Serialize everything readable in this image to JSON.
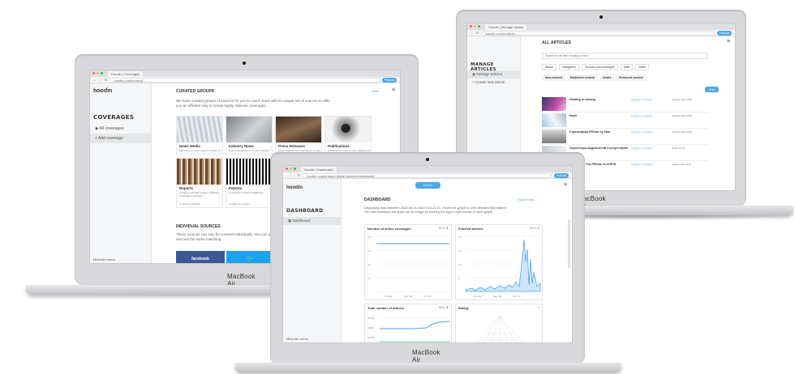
{
  "laptop_brand": "MacBook Air",
  "coverages_screen": {
    "tab_title": "Hoodin | Coverages",
    "url": "hoodin.com/product/...",
    "user_pill": "Pascal",
    "logo": "hoodin",
    "side_title": "COVERAGES",
    "side_items": [
      "All coverages",
      "Add coverage"
    ],
    "minimize": "Minimize menu",
    "section_title": "CURATED GROUPS",
    "section_link": "Hide",
    "intro": "We have curated groups of sources for you to cover. Each with its unique set of sources to offer you an efficient way to create highly relevant coverages.",
    "cards": [
      {
        "title": "News Media",
        "desc": "Mainstream news media from local to international outlets.",
        "meta": "Contains 63 sources"
      },
      {
        "title": "Industry News",
        "desc": "News and updates from your industry.",
        "meta": "Contains 19 sources"
      },
      {
        "title": "Press Releases",
        "desc": "Press releases from companies & organizations.",
        "meta": "Contains 34 sources"
      },
      {
        "title": "Publications",
        "desc": "Publications & reports from leading publishers.",
        "meta": "Contains 26 sources"
      },
      {
        "title": "Reports",
        "desc": "Articles & scientific studies published by academic journals.",
        "meta": "Contains 8 sources"
      },
      {
        "title": "Patents",
        "desc": "A collection of patent databases.",
        "meta": "Contains 3 sources"
      }
    ],
    "individual_title": "INDIVIDUAL SOURCES",
    "individual_intro": "These sources can only be covered individually. You can add pages or accounts for each source and use the same matching.",
    "social": [
      "facebook",
      "twitter"
    ],
    "social_colors": [
      "#3b5998",
      "#1da1f2"
    ]
  },
  "articles_screen": {
    "tab_title": "Hoodin | Manage stories",
    "url": "hoodin.com/product/...",
    "user_pill": "Pascal",
    "side_title": "MANAGE ARTICLES",
    "side_items": [
      "Manage articles",
      "Create new article"
    ],
    "header": "ALL ARTICLES",
    "search_placeholder": "Search for an item heading or text",
    "filters": [
      "Status",
      "Categories",
      "Sources and coverages",
      "Date",
      "Other"
    ],
    "tabs": [
      "New content",
      "Published content",
      "Drafts",
      "Removed content"
    ],
    "edit_button": "Edit",
    "rows": [
      {
        "title": "Heading is missing",
        "status": "Category is missing",
        "date": "October 16th 2018"
      },
      {
        "title": "Hepti",
        "status": "Category is missing",
        "date": "October 16th 2018"
      },
      {
        "title": "Стратосфера PRCam by Sara",
        "status": "Category is missing",
        "date": "October 16th 2018"
      },
      {
        "title": "Скульпторы видеосистем и сопутствующих продуктов...",
        "status": "Category is missing",
        "date": "Today 19:53"
      },
      {
        "title": "Leafiesting This PRCam VLOGP18",
        "status": "Category is missing",
        "date": "August 23rd 2018"
      }
    ]
  },
  "dashboard_screen": {
    "tab_title": "Hoodin | Dashboard",
    "url": "hoodin.com/product-digital-services/dashboard",
    "user_pill": "Pascal",
    "top_button": "Demo",
    "logo": "hoodin",
    "side_title": "DASHBOARD",
    "side_items": [
      "Dashboard"
    ],
    "minimize": "Minimize menu",
    "title": "DASHBOARD",
    "link": "Export view",
    "intro": "Displaying data between 2018-08-01 and 2018-11-07. Hover the graph to view detailed information. You can download the graph as an image by clicking the upper right corner of each graph.",
    "panels": [
      "Number of active coverages",
      "Fetched articles",
      "Total number of articles",
      "Rating"
    ],
    "x_ticks_a": [
      "15 Aug",
      "Sep '18",
      "Oct '18"
    ],
    "x_ticks_b": [
      "15 Aug",
      "Sep '18",
      "Oct '18"
    ],
    "y_ticks_a": [
      "20",
      "15",
      "10",
      "5",
      "0"
    ],
    "y_ticks_b": [
      "20",
      "15",
      "10",
      "5"
    ],
    "y_ticks_c": [
      "30000",
      "20000",
      "10000"
    ]
  },
  "colors": {
    "accent": "#4aa8e8",
    "chart_line": "#4aa8e8",
    "chart_green": "#7ed3a4"
  }
}
